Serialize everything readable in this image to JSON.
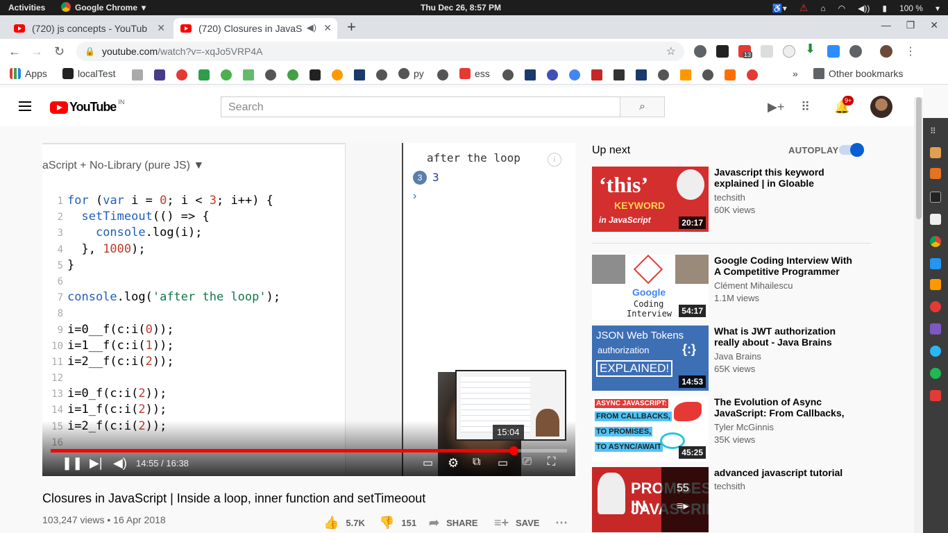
{
  "system": {
    "activities": "Activities",
    "app_name": "Google Chrome",
    "clock": "Thu Dec 26,  8:57 PM",
    "battery": "100 %"
  },
  "tabs": [
    {
      "title": "(720) js concepts - YouTub"
    },
    {
      "title": "(720) Closures in JavaS"
    }
  ],
  "address": {
    "host": "youtube.com",
    "path": "/watch?v=-xqJo5VRP4A",
    "ext_badge": "13"
  },
  "bookmarks": {
    "apps": "Apps",
    "localtest": "localTest",
    "py": "py",
    "ess": "ess",
    "overflow": "»",
    "other": "Other bookmarks"
  },
  "youtube": {
    "logo": "YouTube",
    "country": "IN",
    "search_placeholder": "Search",
    "notif_badge": "9+"
  },
  "player": {
    "editor_header": "aScript + No-Library (pure JS) ▼",
    "code_lines": [
      {
        "n": "1",
        "text": "for (var i = 0; i < 3; i++) {"
      },
      {
        "n": "2",
        "text": "  setTimeout(() => {"
      },
      {
        "n": "3",
        "text": "    console.log(i);"
      },
      {
        "n": "4",
        "text": "  }, 1000);"
      },
      {
        "n": "5",
        "text": "}"
      },
      {
        "n": "6",
        "text": ""
      },
      {
        "n": "7",
        "text": "console.log('after the loop');"
      },
      {
        "n": "8",
        "text": ""
      },
      {
        "n": "9",
        "text": "i=0__f(c:i(0));"
      },
      {
        "n": "10",
        "text": "i=1__f(c:i(1));"
      },
      {
        "n": "11",
        "text": "i=2__f(c:i(2));"
      },
      {
        "n": "12",
        "text": ""
      },
      {
        "n": "13",
        "text": "i=0_f(c:i(2));"
      },
      {
        "n": "14",
        "text": "i=1_f(c:i(2));"
      },
      {
        "n": "15",
        "text": "i=2_f(c:i(2));"
      },
      {
        "n": "16",
        "text": ""
      }
    ],
    "console_first": "after the loop",
    "console_count": "3",
    "console_value": "3",
    "console_prompt": "›",
    "info": "i",
    "preview_time": "15:04",
    "time": "14:55 / 16:38",
    "progress_fraction": 0.897
  },
  "video": {
    "title": "Closures in JavaScript | Inside a loop, inner function and setTimeoout",
    "meta": "103,247 views • 16 Apr 2018",
    "likes": "5.7K",
    "dislikes": "151",
    "share": "SHARE",
    "save": "SAVE"
  },
  "sidebar": {
    "up_next": "Up next",
    "autoplay": "AUTOPLAY",
    "items": [
      {
        "title": "Javascript this keyword explained | in Gloable Scope,...",
        "channel": "techsith",
        "views": "60K views",
        "duration": "20:17",
        "thumb_text1": "‘this’",
        "thumb_text2": "KEYWORD",
        "thumb_text3": "in JavaScript"
      },
      {
        "title": "Google Coding Interview With A Competitive Programmer",
        "channel": "Clément Mihailescu",
        "views": "1.1M views",
        "duration": "54:17",
        "thumb_text1": "Google",
        "thumb_text2": "Coding",
        "thumb_text3": "Interview"
      },
      {
        "title": "What is JWT authorization really about - Java Brains",
        "channel": "Java Brains",
        "views": "65K views",
        "duration": "14:53",
        "thumb_text1": "JSON Web Tokens",
        "thumb_text2": "authorization",
        "thumb_text3": "EXPLAINED!"
      },
      {
        "title": "The Evolution of Async JavaScript: From Callbacks, to...",
        "channel": "Tyler McGinnis",
        "views": "35K views",
        "duration": "45:25",
        "thumb_text1": "ASYNC JAVASCRIPT:",
        "thumb_text2": "FROM CALLBACKS,",
        "thumb_text3": "TO PROMISES,",
        "thumb_text4": "TO ASYNC/AWAIT"
      },
      {
        "title": "advanced javascript tutorial",
        "channel": "techsith",
        "views": "",
        "duration": "",
        "thumb_text1": "PROMISES IN",
        "thumb_text2": "JAVASCRIPT",
        "playlist_count": "55"
      }
    ]
  }
}
